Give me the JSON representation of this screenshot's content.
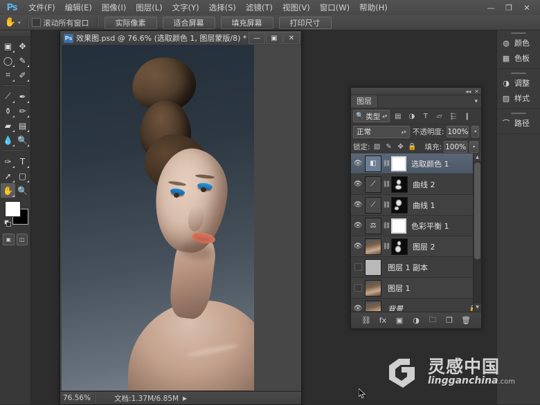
{
  "app": {
    "logo": "Ps",
    "title": "Adobe Photoshop"
  },
  "menubar": {
    "items": [
      {
        "label": "文件(F)",
        "name": "menu-file"
      },
      {
        "label": "编辑(E)",
        "name": "menu-edit"
      },
      {
        "label": "图像(I)",
        "name": "menu-image"
      },
      {
        "label": "图层(L)",
        "name": "menu-layer"
      },
      {
        "label": "文字(Y)",
        "name": "menu-type"
      },
      {
        "label": "选择(S)",
        "name": "menu-select"
      },
      {
        "label": "滤镜(T)",
        "name": "menu-filter"
      },
      {
        "label": "视图(V)",
        "name": "menu-view"
      },
      {
        "label": "窗口(W)",
        "name": "menu-window"
      },
      {
        "label": "帮助(H)",
        "name": "menu-help"
      }
    ],
    "window_controls": {
      "minimize": "—",
      "restore": "❐",
      "close": "✕"
    }
  },
  "options_bar": {
    "tool_icon": "hand-tool-icon",
    "tool_glyph": "✋",
    "scroll_all_windows": "滚动所有窗口",
    "scroll_all_windows_checked": false,
    "buttons": [
      {
        "label": "实际像素",
        "name": "actual-pixels-button"
      },
      {
        "label": "适合屏幕",
        "name": "fit-screen-button"
      },
      {
        "label": "填充屏幕",
        "name": "fill-screen-button"
      },
      {
        "label": "打印尺寸",
        "name": "print-size-button"
      }
    ]
  },
  "toolbox": {
    "tools": [
      {
        "name": "marquee-tool",
        "glyph": "▣",
        "selected": false,
        "has_flyout": true
      },
      {
        "name": "move-tool",
        "glyph": "✥",
        "selected": false,
        "has_flyout": false
      },
      {
        "name": "lasso-tool",
        "glyph": "◯",
        "selected": false,
        "has_flyout": true
      },
      {
        "name": "quick-selection-tool",
        "glyph": "✎",
        "selected": false,
        "has_flyout": true
      },
      {
        "name": "crop-tool",
        "glyph": "⌗",
        "selected": false,
        "has_flyout": true
      },
      {
        "name": "eyedropper-tool",
        "glyph": "✐",
        "selected": false,
        "has_flyout": true
      },
      {
        "name": "spot-healing-tool",
        "glyph": "⟋",
        "selected": false,
        "has_flyout": true
      },
      {
        "name": "brush-tool",
        "glyph": "✒",
        "selected": false,
        "has_flyout": true
      },
      {
        "name": "clone-stamp-tool",
        "glyph": "⚱",
        "selected": false,
        "has_flyout": true
      },
      {
        "name": "history-brush-tool",
        "glyph": "✏",
        "selected": false,
        "has_flyout": true
      },
      {
        "name": "eraser-tool",
        "glyph": "▰",
        "selected": false,
        "has_flyout": true
      },
      {
        "name": "gradient-tool",
        "glyph": "▤",
        "selected": false,
        "has_flyout": true
      },
      {
        "name": "blur-tool",
        "glyph": "💧",
        "selected": false,
        "has_flyout": true
      },
      {
        "name": "dodge-tool",
        "glyph": "🔍",
        "selected": false,
        "has_flyout": true
      },
      {
        "name": "pen-tool",
        "glyph": "✑",
        "selected": false,
        "has_flyout": true
      },
      {
        "name": "type-tool",
        "glyph": "T",
        "selected": false,
        "has_flyout": true
      },
      {
        "name": "path-selection-tool",
        "glyph": "➚",
        "selected": false,
        "has_flyout": true
      },
      {
        "name": "shape-tool",
        "glyph": "▢",
        "selected": false,
        "has_flyout": true
      },
      {
        "name": "hand-tool",
        "glyph": "✋",
        "selected": true,
        "has_flyout": true
      },
      {
        "name": "zoom-tool",
        "glyph": "🔍",
        "selected": false,
        "has_flyout": false
      }
    ],
    "foreground_color": "#ffffff",
    "background_color": "#000000",
    "screen_modes": [
      {
        "name": "standard-screen-mode",
        "glyph": "▣"
      },
      {
        "name": "quick-mask-mode",
        "glyph": "◫"
      }
    ]
  },
  "document": {
    "icon_label": "Ps",
    "title": "效果图.psd @ 76.6% (选取颜色 1, 图层蒙版/8) *",
    "window_controls": {
      "minimize": "—",
      "maximize": "▣",
      "close": "✕"
    },
    "status": {
      "zoom": "76.56%",
      "doc_label": "文档:1.37M/6.85M",
      "arrow": "▶"
    }
  },
  "layers_panel": {
    "tab_label": "图层",
    "menu_glyph": "▾",
    "collapse_glyph": "◂◂",
    "close_glyph": "✕",
    "filter": {
      "search_glyph": "🔍",
      "kind_label": "类型",
      "icons": [
        {
          "name": "filter-pixel-icon",
          "glyph": "▤"
        },
        {
          "name": "filter-adjustment-icon",
          "glyph": "◑"
        },
        {
          "name": "filter-type-icon",
          "glyph": "T"
        },
        {
          "name": "filter-shape-icon",
          "glyph": "▱"
        },
        {
          "name": "filter-smart-object-icon",
          "glyph": "⬱"
        },
        {
          "name": "filter-toggle-icon",
          "glyph": "❙"
        }
      ]
    },
    "blend_mode": "正常",
    "opacity_label": "不透明度:",
    "opacity_value": "100%",
    "lock_label": "锁定:",
    "lock_icons": [
      {
        "name": "lock-transparent-pixels-icon",
        "glyph": "▨"
      },
      {
        "name": "lock-image-pixels-icon",
        "glyph": "✎"
      },
      {
        "name": "lock-position-icon",
        "glyph": "✥"
      },
      {
        "name": "lock-all-icon",
        "glyph": "🔒"
      }
    ],
    "fill_label": "填充:",
    "fill_value": "100%",
    "layers": [
      {
        "name": "选取颜色 1",
        "visible": true,
        "selected": true,
        "thumb_type": "adjustment-selective-color",
        "thumb_glyph": "◧",
        "has_link": true,
        "mask": "white",
        "locked": false
      },
      {
        "name": "曲线 2",
        "visible": true,
        "selected": false,
        "thumb_type": "adjustment-curves",
        "thumb_glyph": "⟋",
        "has_link": true,
        "mask": "black",
        "locked": false
      },
      {
        "name": "曲线 1",
        "visible": true,
        "selected": false,
        "thumb_type": "adjustment-curves",
        "thumb_glyph": "⟋",
        "has_link": true,
        "mask": "black",
        "locked": false
      },
      {
        "name": "色彩平衡 1",
        "visible": true,
        "selected": false,
        "thumb_type": "adjustment-color-balance",
        "thumb_glyph": "⚖",
        "has_link": true,
        "mask": "white",
        "locked": false
      },
      {
        "name": "图层 2",
        "visible": true,
        "selected": false,
        "thumb_type": "photo",
        "thumb_glyph": "",
        "has_link": true,
        "mask": "black",
        "locked": false
      },
      {
        "name": "图层 1 副本",
        "visible": false,
        "selected": false,
        "thumb_type": "blank",
        "thumb_glyph": "",
        "has_link": false,
        "mask": "none",
        "locked": false
      },
      {
        "name": "图层 1",
        "visible": false,
        "selected": false,
        "thumb_type": "photo",
        "thumb_glyph": "",
        "has_link": false,
        "mask": "none",
        "locked": false
      },
      {
        "name": "背景",
        "visible": true,
        "selected": false,
        "thumb_type": "photo",
        "thumb_glyph": "",
        "has_link": false,
        "mask": "none",
        "locked": true,
        "lock_glyph": "🔒"
      }
    ],
    "bottom_buttons": [
      {
        "name": "link-layers-button",
        "glyph": "⛓"
      },
      {
        "name": "layer-style-button",
        "glyph": "fx"
      },
      {
        "name": "add-layer-mask-button",
        "glyph": "▣"
      },
      {
        "name": "new-adjustment-layer-button",
        "glyph": "◑"
      },
      {
        "name": "new-group-button",
        "glyph": "🗀"
      },
      {
        "name": "new-layer-button",
        "glyph": "❐"
      },
      {
        "name": "delete-layer-button",
        "glyph": "🗑"
      }
    ]
  },
  "dock": {
    "groups": [
      {
        "items": [
          {
            "label": "颜色",
            "name": "dock-color",
            "icon": "color-wheel-icon",
            "glyph": "◍"
          },
          {
            "label": "色板",
            "name": "dock-swatches",
            "icon": "swatches-icon",
            "glyph": "▦"
          }
        ]
      },
      {
        "items": [
          {
            "label": "调整",
            "name": "dock-adjustments",
            "icon": "adjustment-icon",
            "glyph": "◑"
          },
          {
            "label": "样式",
            "name": "dock-styles",
            "icon": "styles-icon",
            "glyph": "▨"
          }
        ]
      },
      {
        "items": [
          {
            "label": "路径",
            "name": "dock-paths",
            "icon": "paths-icon",
            "glyph": "⌒"
          }
        ]
      }
    ]
  },
  "watermark": {
    "chinese": "灵感中国",
    "english": "lingganchina",
    "domain": ".com"
  },
  "colors": {
    "accent_blue": "#5fb0e8",
    "panel_bg": "#3a3a3a",
    "app_bg": "#2d2d2d",
    "selected_row": "#5a6777",
    "canvas_bg_top": "#232f3a",
    "canvas_bg_bottom": "#7e8791"
  }
}
